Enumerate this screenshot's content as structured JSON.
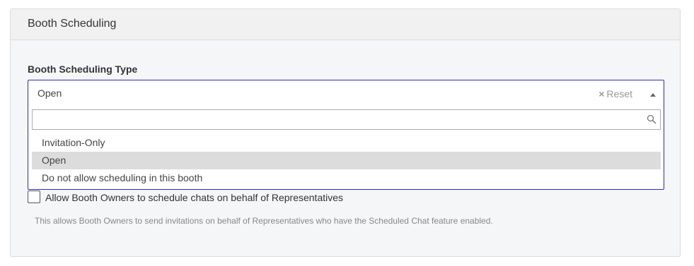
{
  "panel": {
    "title": "Booth Scheduling"
  },
  "scheduling_type": {
    "label": "Booth Scheduling Type",
    "selected_value": "Open",
    "reset_icon": "×",
    "reset_label": "Reset",
    "search_value": "",
    "options": [
      {
        "label": "Invitation-Only",
        "selected": false
      },
      {
        "label": "Open",
        "selected": true
      },
      {
        "label": "Do not allow scheduling in this booth",
        "selected": false
      }
    ]
  },
  "allow_owners": {
    "checked": false,
    "label": "Allow Booth Owners to schedule chats on behalf of Representatives",
    "help": "This allows Booth Owners to send invitations on behalf of Representatives who have the Scheduled Chat feature enabled."
  },
  "colors": {
    "focus_border": "#2a2ac8",
    "selected_option_bg": "#dcdcdc"
  }
}
